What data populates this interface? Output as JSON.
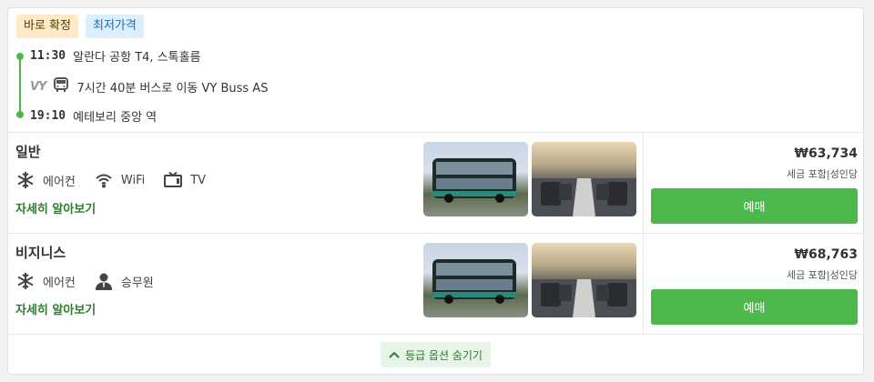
{
  "badges": {
    "instant": "바로 확정",
    "cheapest": "최저가격"
  },
  "route": {
    "depart_time": "11:30",
    "depart_place": "알란다 공항 T4, 스톡홀름",
    "operator_logo": "VY",
    "bus_icon": "bus-icon",
    "duration_text": "7시간 40분 버스로 이동 VY Buss AS",
    "arrive_time": "19:10",
    "arrive_place": "예테보리 중앙 역"
  },
  "fares": [
    {
      "name": "일반",
      "amenities": [
        {
          "icon": "snowflake-icon",
          "label": "에어컨"
        },
        {
          "icon": "wifi-icon",
          "label": "WiFi"
        },
        {
          "icon": "tv-icon",
          "label": "TV"
        }
      ],
      "details_link": "자세히 알아보기",
      "price": "₩63,734",
      "price_note": "세금 포함|성인당",
      "book_label": "예매"
    },
    {
      "name": "비지니스",
      "amenities": [
        {
          "icon": "snowflake-icon",
          "label": "에어컨"
        },
        {
          "icon": "person-icon",
          "label": "승무원"
        }
      ],
      "details_link": "자세히 알아보기",
      "price": "₩68,763",
      "price_note": "세금 포함|성인당",
      "book_label": "예매"
    }
  ],
  "footer": {
    "hide_options_label": "등급 옵션 숨기기"
  },
  "colors": {
    "accent": "#4cb84c",
    "link": "#2e7d32"
  }
}
